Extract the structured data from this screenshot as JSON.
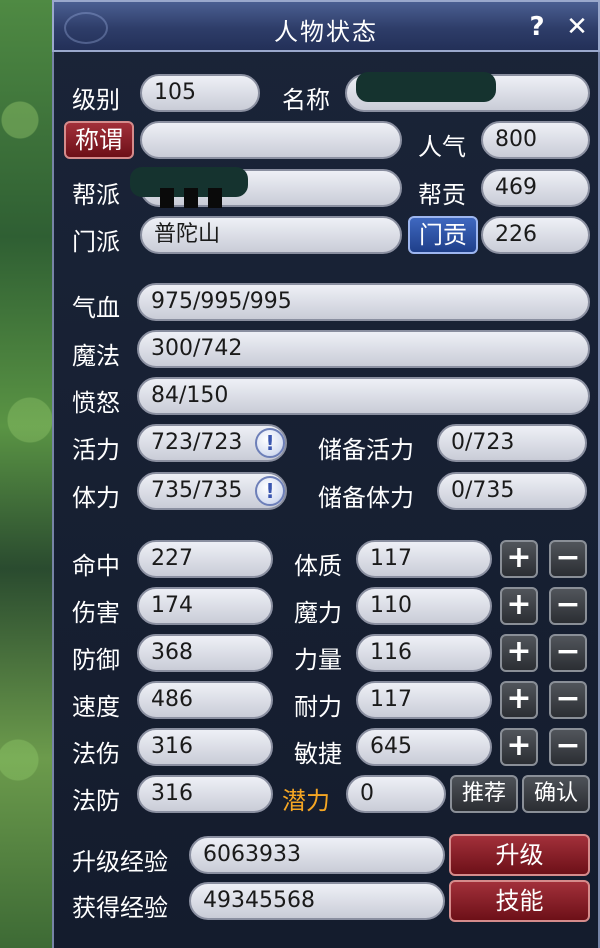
{
  "window": {
    "title": "人物状态",
    "help": "?",
    "close": "✕"
  },
  "profile": {
    "level_label": "级别",
    "level_value": "105",
    "name_label": "名称",
    "name_value": "",
    "title_button": "称谓",
    "title_value": "",
    "popularity_label": "人气",
    "popularity_value": "800",
    "guild_label": "帮派",
    "guild_value": "",
    "guild_contrib_label": "帮贡",
    "guild_contrib_value": "469",
    "sect_label": "门派",
    "sect_value": "普陀山",
    "sect_contrib_button": "门贡",
    "sect_contrib_value": "226"
  },
  "vitals": {
    "hp_label": "气血",
    "hp_value": "975/995/995",
    "mp_label": "魔法",
    "mp_value": "300/742",
    "rage_label": "愤怒",
    "rage_value": "84/150",
    "vitality_label": "活力",
    "vitality_value": "723/723",
    "reserve_vitality_label": "储备活力",
    "reserve_vitality_value": "0/723",
    "stamina_label": "体力",
    "stamina_value": "735/735",
    "reserve_stamina_label": "储备体力",
    "reserve_stamina_value": "0/735"
  },
  "combat": [
    {
      "label": "命中",
      "value": "227"
    },
    {
      "label": "伤害",
      "value": "174"
    },
    {
      "label": "防御",
      "value": "368"
    },
    {
      "label": "速度",
      "value": "486"
    },
    {
      "label": "法伤",
      "value": "316"
    },
    {
      "label": "法防",
      "value": "316"
    }
  ],
  "attributes": [
    {
      "label": "体质",
      "value": "117"
    },
    {
      "label": "魔力",
      "value": "110"
    },
    {
      "label": "力量",
      "value": "116"
    },
    {
      "label": "耐力",
      "value": "117"
    },
    {
      "label": "敏捷",
      "value": "645"
    }
  ],
  "potential": {
    "label": "潜力",
    "value": "0",
    "recommend": "推荐",
    "confirm": "确认"
  },
  "plus": "+",
  "minus": "−",
  "info_glyph": "!",
  "experience": {
    "upgrade_label": "升级经验",
    "upgrade_value": "6063933",
    "upgrade_button": "升级",
    "gained_label": "获得经验",
    "gained_value": "49345568",
    "skills_button": "技能"
  },
  "colors": {
    "accent_red": "#8c1f2a",
    "accent_blue": "#2d4fa3",
    "potential_orange": "#f5a623"
  }
}
